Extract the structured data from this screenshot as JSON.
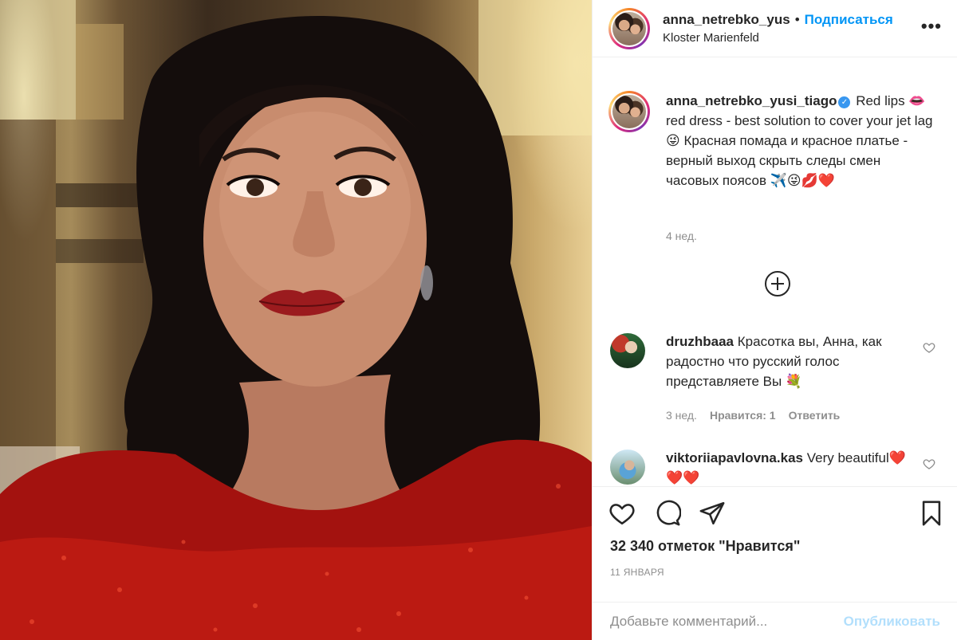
{
  "post": {
    "author": "anna_netrebko_yus",
    "follow_label": "Подписаться",
    "location": "Kloster Marienfeld",
    "more_icon": "more-horizontal-icon"
  },
  "caption": {
    "author": "anna_netrebko_yusi_tiago",
    "text": "Red lips 👄 red dress - best solution to cover your jet lag 😜 Красная помада и красное платье - верный выход скрыть следы смен часовых поясов ✈️😜💋❤️",
    "time": "4 нед."
  },
  "comments": [
    {
      "author": "druzhbaaa",
      "text": "Красотка вы, Анна, как радостно что русский голос представляете Вы 💐",
      "time": "3 нед.",
      "likes": "Нравится: 1",
      "reply": "Ответить"
    },
    {
      "author": "viktoriiapavlovna.kas",
      "text": "Very beautiful❤️❤️❤️"
    }
  ],
  "footer": {
    "likes": "32 340 отметок \"Нравится\"",
    "date": "11 ЯНВАРЯ",
    "comment_placeholder": "Добавьте комментарий...",
    "publish_label": "Опубликовать"
  },
  "colors": {
    "link": "#0095f6",
    "muted": "#8e8e8e",
    "text": "#262626",
    "publish_disabled": "#b2dffc"
  }
}
